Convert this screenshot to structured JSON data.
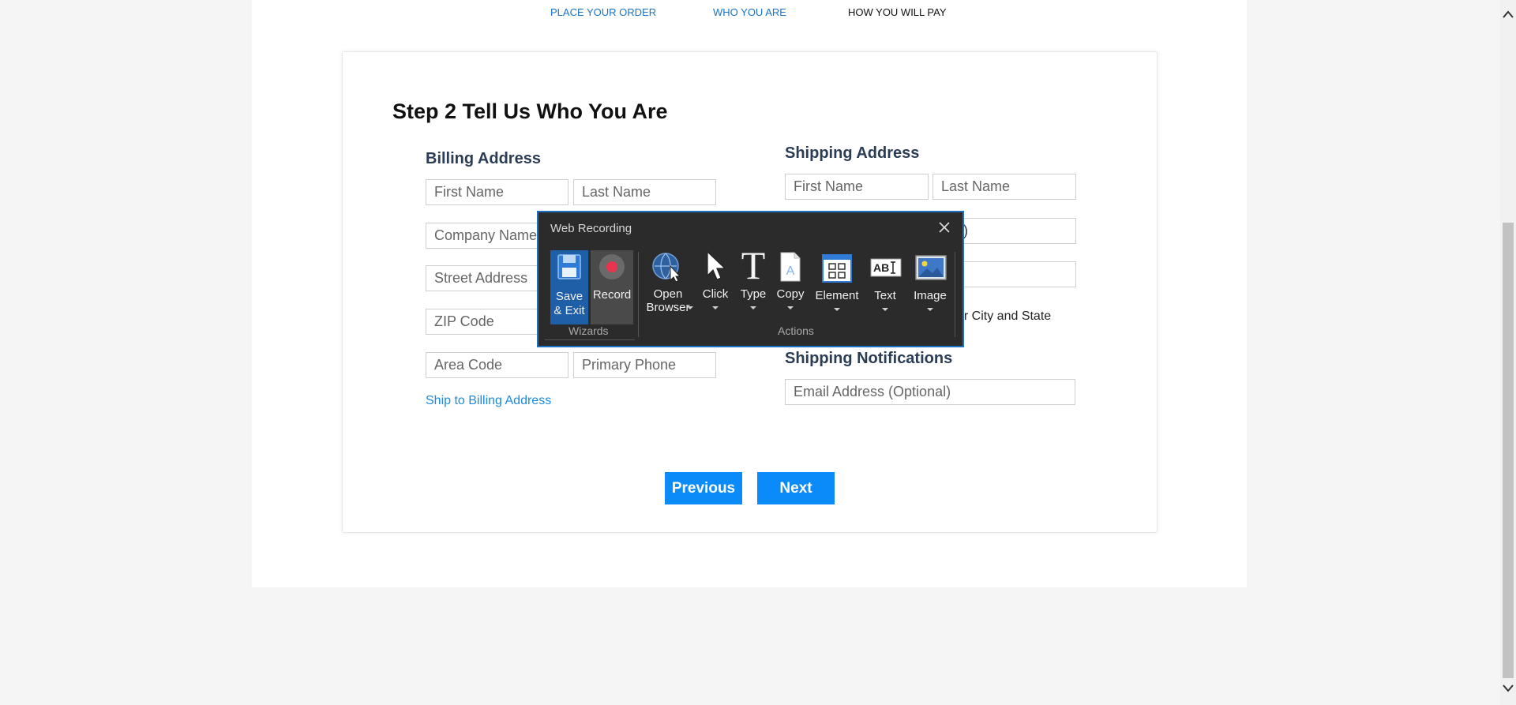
{
  "steps": {
    "place_order": "PLACE YOUR ORDER",
    "who_you_are": "WHO YOU ARE",
    "how_you_pay": "HOW YOU WILL PAY"
  },
  "form": {
    "title": "Step 2 Tell Us Who You Are",
    "billing": {
      "heading": "Billing Address",
      "first_name": "First Name",
      "last_name": "Last Name",
      "company": "Company Name",
      "street": "Street Address",
      "zip": "ZIP Code",
      "area_code": "Area Code",
      "primary_phone": "Primary Phone",
      "ship_link": "Ship to Billing Address"
    },
    "shipping": {
      "heading": "Shipping Address",
      "first_name": "First Name",
      "last_name": "Last Name",
      "company_partial": ")",
      "city_state_partial": "or City and State"
    },
    "notifications": {
      "heading": "Shipping Notifications",
      "email": "Email Address (Optional)"
    },
    "previous": "Previous",
    "next": "Next"
  },
  "recorder": {
    "title": "Web Recording",
    "tools": {
      "save_line1": "Save",
      "save_line2": "& Exit",
      "record": "Record",
      "open_line1": "Open",
      "open_line2": "Browser",
      "click": "Click",
      "type": "Type",
      "copy": "Copy",
      "element": "Element",
      "text": "Text",
      "image": "Image"
    },
    "groups": {
      "wizards": "Wizards",
      "actions": "Actions"
    }
  },
  "colors": {
    "accent_blue": "#0b8bf7",
    "link_blue": "#1a73c7",
    "recorder_bg": "#2b2b2b",
    "record_red": "#e8344e"
  }
}
